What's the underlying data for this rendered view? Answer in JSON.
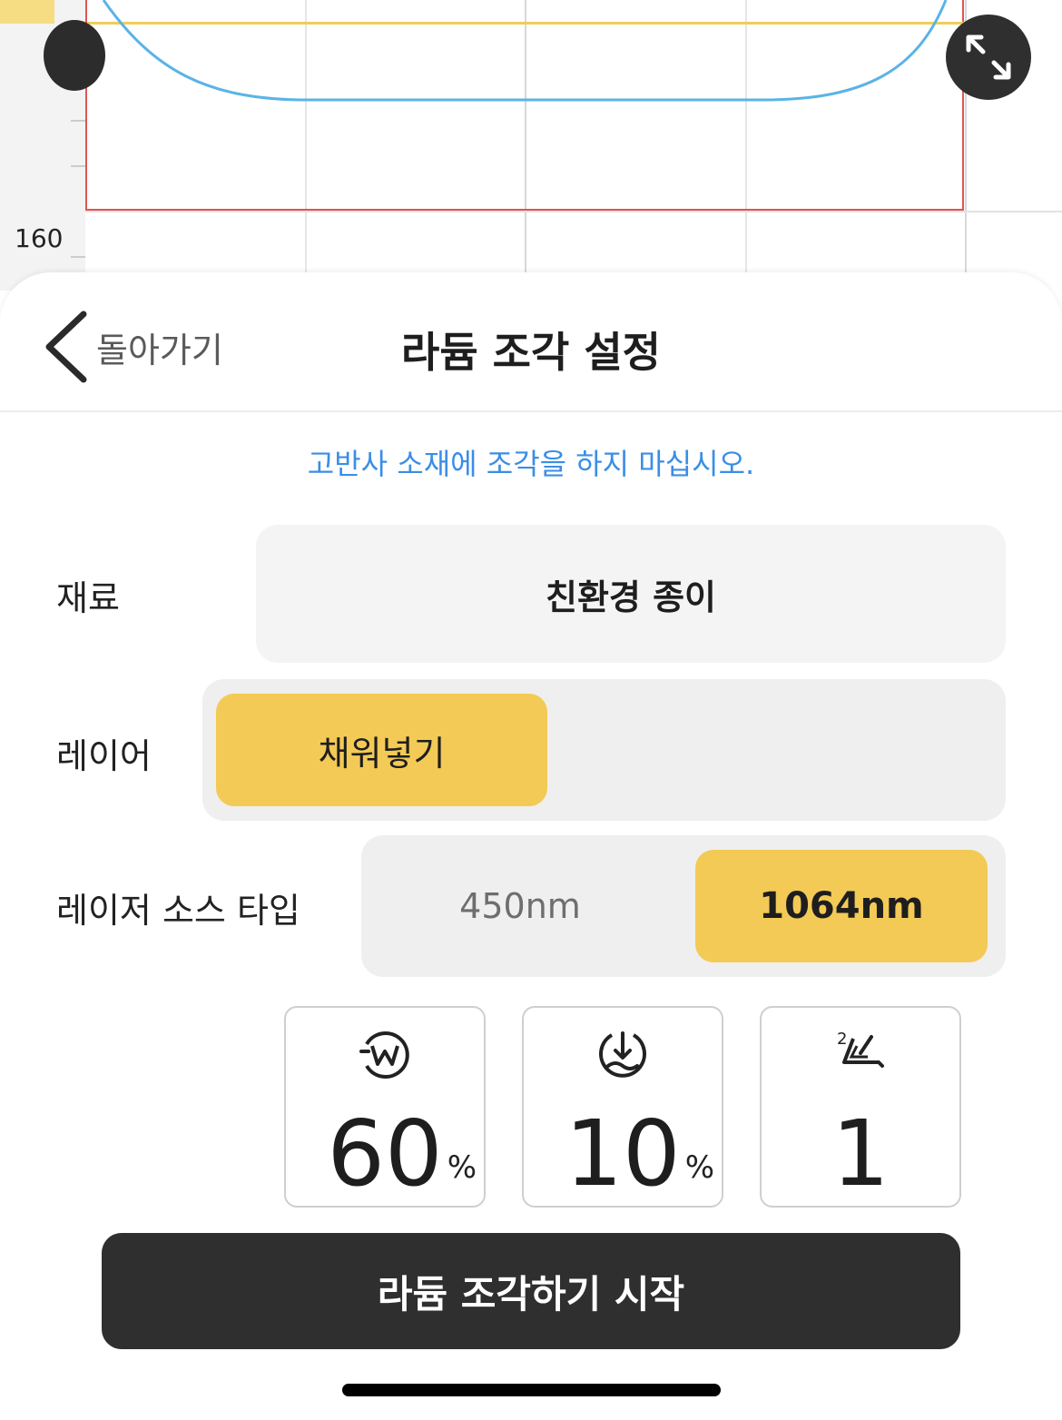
{
  "canvas": {
    "ruler_label": "160"
  },
  "header": {
    "back_label": "돌아가기",
    "title": "라듐 조각 설정"
  },
  "warning": "고반사 소재에 조각을 하지 마십시오.",
  "material": {
    "label": "재료",
    "value": "친환경 종이"
  },
  "layer": {
    "label": "레이어",
    "selected": "채워넣기"
  },
  "laser_source": {
    "label": "레이저 소스 타입",
    "options": [
      "450nm",
      "1064nm"
    ],
    "selected": "1064nm"
  },
  "params": [
    {
      "icon": "power-w-icon",
      "value": "60",
      "unit": "%"
    },
    {
      "icon": "speed-icon",
      "value": "10",
      "unit": "%"
    },
    {
      "icon": "pass-count-icon",
      "value": "1",
      "unit": ""
    }
  ],
  "start_button": "라듐 조각하기 시작",
  "colors": {
    "accent": "#f3ca55",
    "link": "#3a8ee6",
    "dark": "#2f2f2f",
    "outline_red": "#e0554f",
    "shape_blue": "#5ab3e6"
  }
}
